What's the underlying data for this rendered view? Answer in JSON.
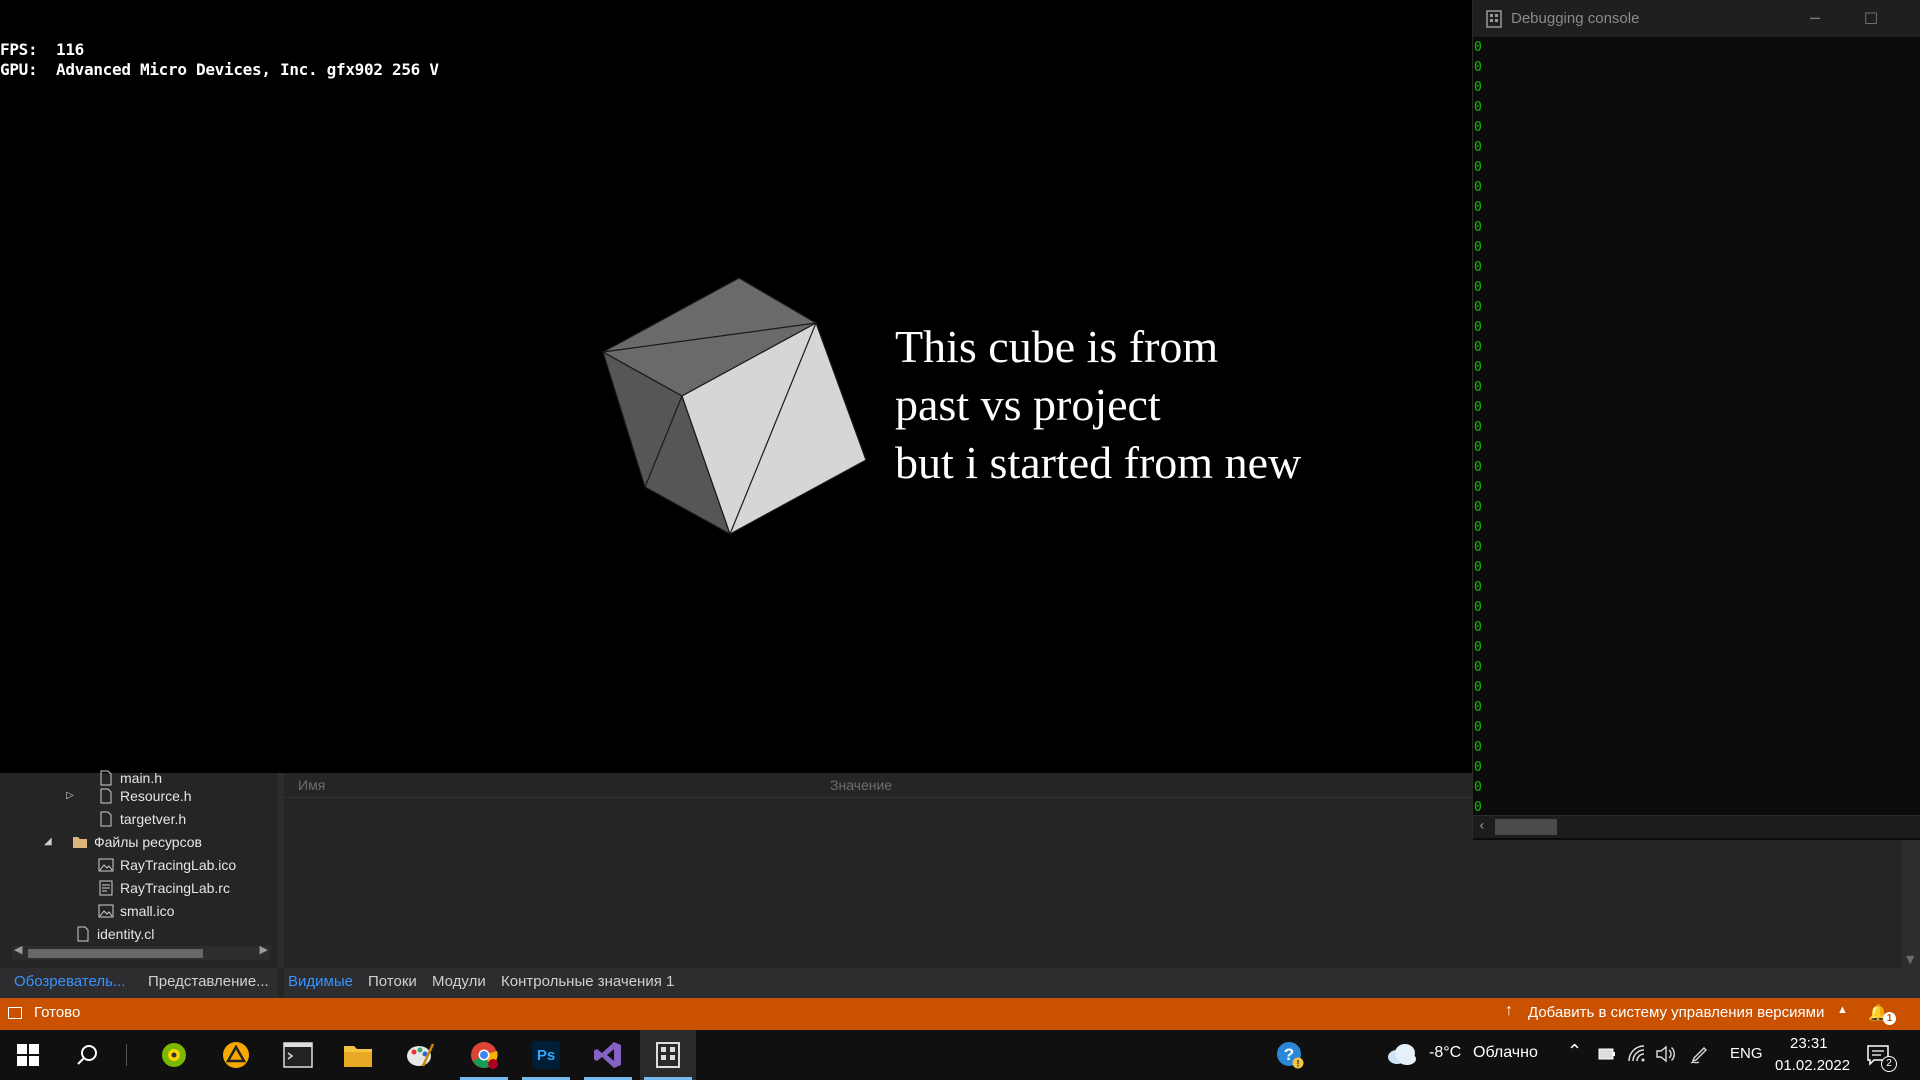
{
  "overlay": {
    "fps_label": "FPS:",
    "fps_value": "116",
    "gpu_label": "GPU:",
    "gpu_value": "Advanced Micro Devices, Inc. gfx902 256 V"
  },
  "caption": {
    "line1": "This cube is from",
    "line2": "past vs project",
    "line3": "but i started from new"
  },
  "console": {
    "title": "Debugging console",
    "icon": "console-app-icon",
    "output_lines": [
      "0",
      "0",
      "0",
      "0",
      "0",
      "0",
      "0",
      "0",
      "0",
      "0",
      "0",
      "0",
      "0",
      "0",
      "0",
      "0",
      "0",
      "0",
      "0",
      "0",
      "0",
      "0",
      "0",
      "0",
      "0",
      "0",
      "0",
      "0",
      "0",
      "0",
      "0",
      "0",
      "0",
      "0",
      "0",
      "0",
      "0",
      "0",
      "0"
    ],
    "text_color": "#13c400"
  },
  "solution_explorer": {
    "items": [
      {
        "label": "main.h",
        "icon": "header-file-icon"
      },
      {
        "label": "Resource.h",
        "icon": "header-file-icon"
      },
      {
        "label": "targetver.h",
        "icon": "header-file-icon"
      },
      {
        "label": "Файлы ресурсов",
        "icon": "folder-icon"
      },
      {
        "label": "RayTracingLab.ico",
        "icon": "image-file-icon"
      },
      {
        "label": "RayTracingLab.rc",
        "icon": "resource-file-icon"
      },
      {
        "label": "small.ico",
        "icon": "image-file-icon"
      },
      {
        "label": "identity.cl",
        "icon": "file-icon"
      }
    ],
    "tabs": [
      "Обозреватель...",
      "Представление..."
    ]
  },
  "watch": {
    "columns": [
      "Имя",
      "Значение"
    ],
    "tabs": [
      "Видимые",
      "Потоки",
      "Модули",
      "Контрольные значения 1"
    ]
  },
  "statusbar": {
    "status": "Готово",
    "vcs": "Добавить в систему управления версиями",
    "notifications": "1",
    "color": "#ca5100"
  },
  "taskbar": {
    "apps": [
      "windows-start-icon",
      "search-icon",
      "chameleon-app-icon",
      "warning-app-icon",
      "terminal-icon",
      "file-explorer-icon",
      "paint-app-icon",
      "chrome-icon",
      "photoshop-icon",
      "visual-studio-icon",
      "console-app-icon"
    ],
    "photoshop_label": "Ps",
    "weather_temp": "-8°C",
    "weather_desc": "Облачно",
    "lang": "ENG",
    "time": "23:31",
    "date": "01.02.2022",
    "action_center_count": "2"
  }
}
